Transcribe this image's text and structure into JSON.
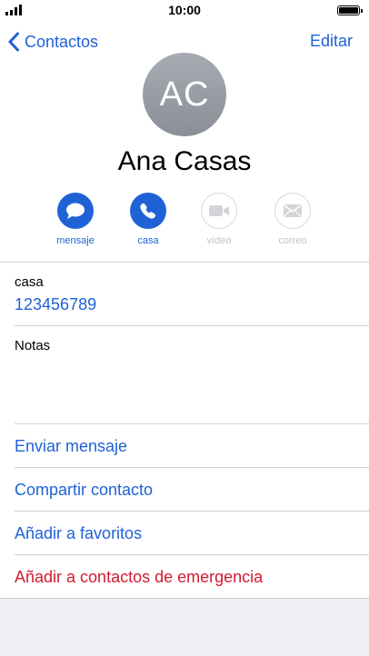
{
  "status_bar": {
    "time": "10:00"
  },
  "nav": {
    "back_label": "Contactos",
    "edit_label": "Editar"
  },
  "contact": {
    "initials": "AC",
    "name": "Ana Casas"
  },
  "actions": [
    {
      "label": "mensaje",
      "icon": "message-icon",
      "enabled": true
    },
    {
      "label": "casa",
      "icon": "phone-icon",
      "enabled": true
    },
    {
      "label": "vídeo",
      "icon": "video-icon",
      "enabled": false
    },
    {
      "label": "correo",
      "icon": "mail-icon",
      "enabled": false
    }
  ],
  "phone_field": {
    "label": "casa",
    "value": "123456789"
  },
  "notes_field": {
    "label": "Notas"
  },
  "links": {
    "send_message": "Enviar mensaje",
    "share_contact": "Compartir contacto",
    "add_favorites": "Añadir a favoritos",
    "add_emergency": "Añadir a contactos de emergencia"
  },
  "colors": {
    "accent": "#1f62d6",
    "danger": "#d21b2e",
    "disabled": "#c4c4c8"
  }
}
